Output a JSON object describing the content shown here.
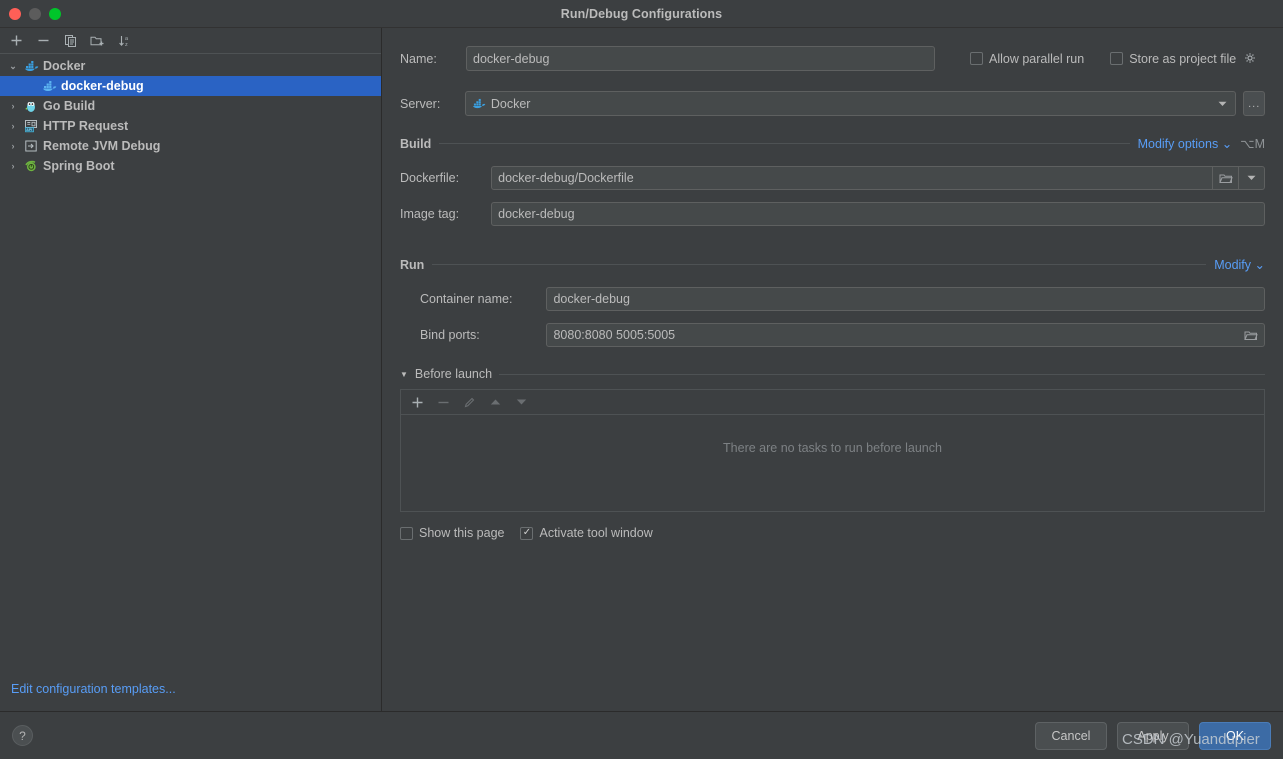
{
  "window": {
    "title": "Run/Debug Configurations",
    "traffic_lights": [
      "close",
      "minimize",
      "zoom"
    ]
  },
  "sidebar": {
    "toolbar": [
      {
        "name": "add-configuration-button",
        "icon": "plus-icon",
        "glyph": "+"
      },
      {
        "name": "remove-configuration-button",
        "icon": "minus-icon",
        "glyph": "−"
      },
      {
        "name": "copy-configuration-button",
        "icon": "copy-icon",
        "glyph": "copy"
      },
      {
        "name": "new-folder-button",
        "icon": "folder-add-icon",
        "glyph": "folder-add"
      },
      {
        "name": "sort-configurations-button",
        "icon": "sort-alpha-icon",
        "glyph": "sort"
      }
    ],
    "tree": [
      {
        "label": "Docker",
        "icon": "docker-icon",
        "expanded": true,
        "twisty": "⌄",
        "level": 0,
        "selected": false
      },
      {
        "label": "docker-debug",
        "icon": "docker-icon",
        "expanded": false,
        "twisty": "",
        "level": 1,
        "selected": true
      },
      {
        "label": "Go Build",
        "icon": "go-gopher-icon",
        "expanded": false,
        "twisty": "›",
        "level": 0,
        "selected": false
      },
      {
        "label": "HTTP Request",
        "icon": "http-api-icon",
        "expanded": false,
        "twisty": "›",
        "level": 0,
        "selected": false
      },
      {
        "label": "Remote JVM Debug",
        "icon": "remote-jvm-icon",
        "expanded": false,
        "twisty": "›",
        "level": 0,
        "selected": false
      },
      {
        "label": "Spring Boot",
        "icon": "spring-boot-icon",
        "expanded": false,
        "twisty": "›",
        "level": 0,
        "selected": false
      }
    ],
    "edit_templates_link": "Edit configuration templates..."
  },
  "form": {
    "name_label": "Name:",
    "name_value": "docker-debug",
    "allow_parallel_run": {
      "label": "Allow parallel run",
      "checked": false
    },
    "store_as_project_file": {
      "label": "Store as project file",
      "checked": false,
      "gear_icon": "gear-icon"
    },
    "server_label": "Server:",
    "server_value": "Docker",
    "server_browse_label": "...",
    "build": {
      "title": "Build",
      "modify_options_link": "Modify options",
      "modify_options_shortcut": "⌥M",
      "dockerfile_label": "Dockerfile:",
      "dockerfile_value": "docker-debug/Dockerfile",
      "image_tag_label": "Image tag:",
      "image_tag_value": "docker-debug"
    },
    "run": {
      "title": "Run",
      "modify_link": "Modify",
      "container_name_label": "Container name:",
      "container_name_value": "docker-debug",
      "bind_ports_label": "Bind ports:",
      "bind_ports_value": "8080:8080 5005:5005"
    },
    "before_launch": {
      "title": "Before launch",
      "toolbar": [
        {
          "name": "add-task-button",
          "icon": "plus-icon",
          "glyph": "+",
          "enabled": true
        },
        {
          "name": "remove-task-button",
          "icon": "minus-icon",
          "glyph": "−",
          "enabled": false
        },
        {
          "name": "edit-task-button",
          "icon": "pencil-icon",
          "glyph": "✎",
          "enabled": false
        },
        {
          "name": "move-task-up-button",
          "icon": "arrow-up-icon",
          "glyph": "▲",
          "enabled": false
        },
        {
          "name": "move-task-down-button",
          "icon": "arrow-down-icon",
          "glyph": "▼",
          "enabled": false
        }
      ],
      "empty_message": "There are no tasks to run before launch"
    },
    "show_this_page": {
      "label": "Show this page",
      "checked": false
    },
    "activate_tool_window": {
      "label": "Activate tool window",
      "checked": true
    }
  },
  "footer": {
    "help_label": "?",
    "cancel_label": "Cancel",
    "apply_label": "Apply",
    "ok_label": "OK"
  },
  "watermark": "CSDN @Yuandupier",
  "colors": {
    "background": "#3c3f41",
    "selection": "#2a63c4",
    "link": "#589df6",
    "primary_button": "#3c6ba5",
    "field_background": "#45494a",
    "text": "#bbbbbb",
    "muted_text": "#7d8184"
  }
}
